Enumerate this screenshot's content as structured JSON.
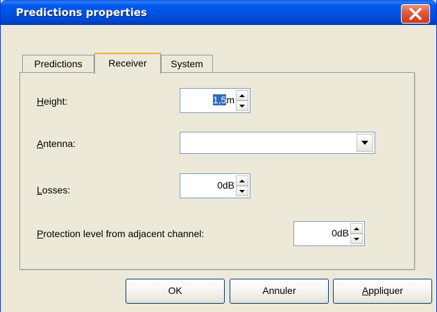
{
  "window": {
    "title": "Predictions properties",
    "close_icon": "close-x-icon",
    "close_color": "#e35b3a",
    "titlebar_color": "#0058ee"
  },
  "tabs": [
    {
      "label": "Predictions",
      "active": false
    },
    {
      "label": "Receiver",
      "active": true
    },
    {
      "label": "System",
      "active": false
    }
  ],
  "receiver": {
    "height": {
      "label_accel": "H",
      "label_rest": "eight:",
      "value": "1,5",
      "unit": "m"
    },
    "antenna": {
      "label_accel": "A",
      "label_rest": "ntenna:",
      "value": ""
    },
    "losses": {
      "label_accel": "L",
      "label_rest": "osses:",
      "value": "0",
      "unit": "dB"
    },
    "protection": {
      "label_accel": "P",
      "label_rest": "rotection level from adjacent channel:",
      "value": "0",
      "unit": "dB"
    }
  },
  "buttons": {
    "ok": "OK",
    "cancel": "Annuler",
    "apply_accel": "A",
    "apply_rest": "ppliquer"
  },
  "colors": {
    "dialog_bg": "#ece9d8",
    "tab_highlight": "#f8ae36",
    "selection": "#316ac5"
  }
}
